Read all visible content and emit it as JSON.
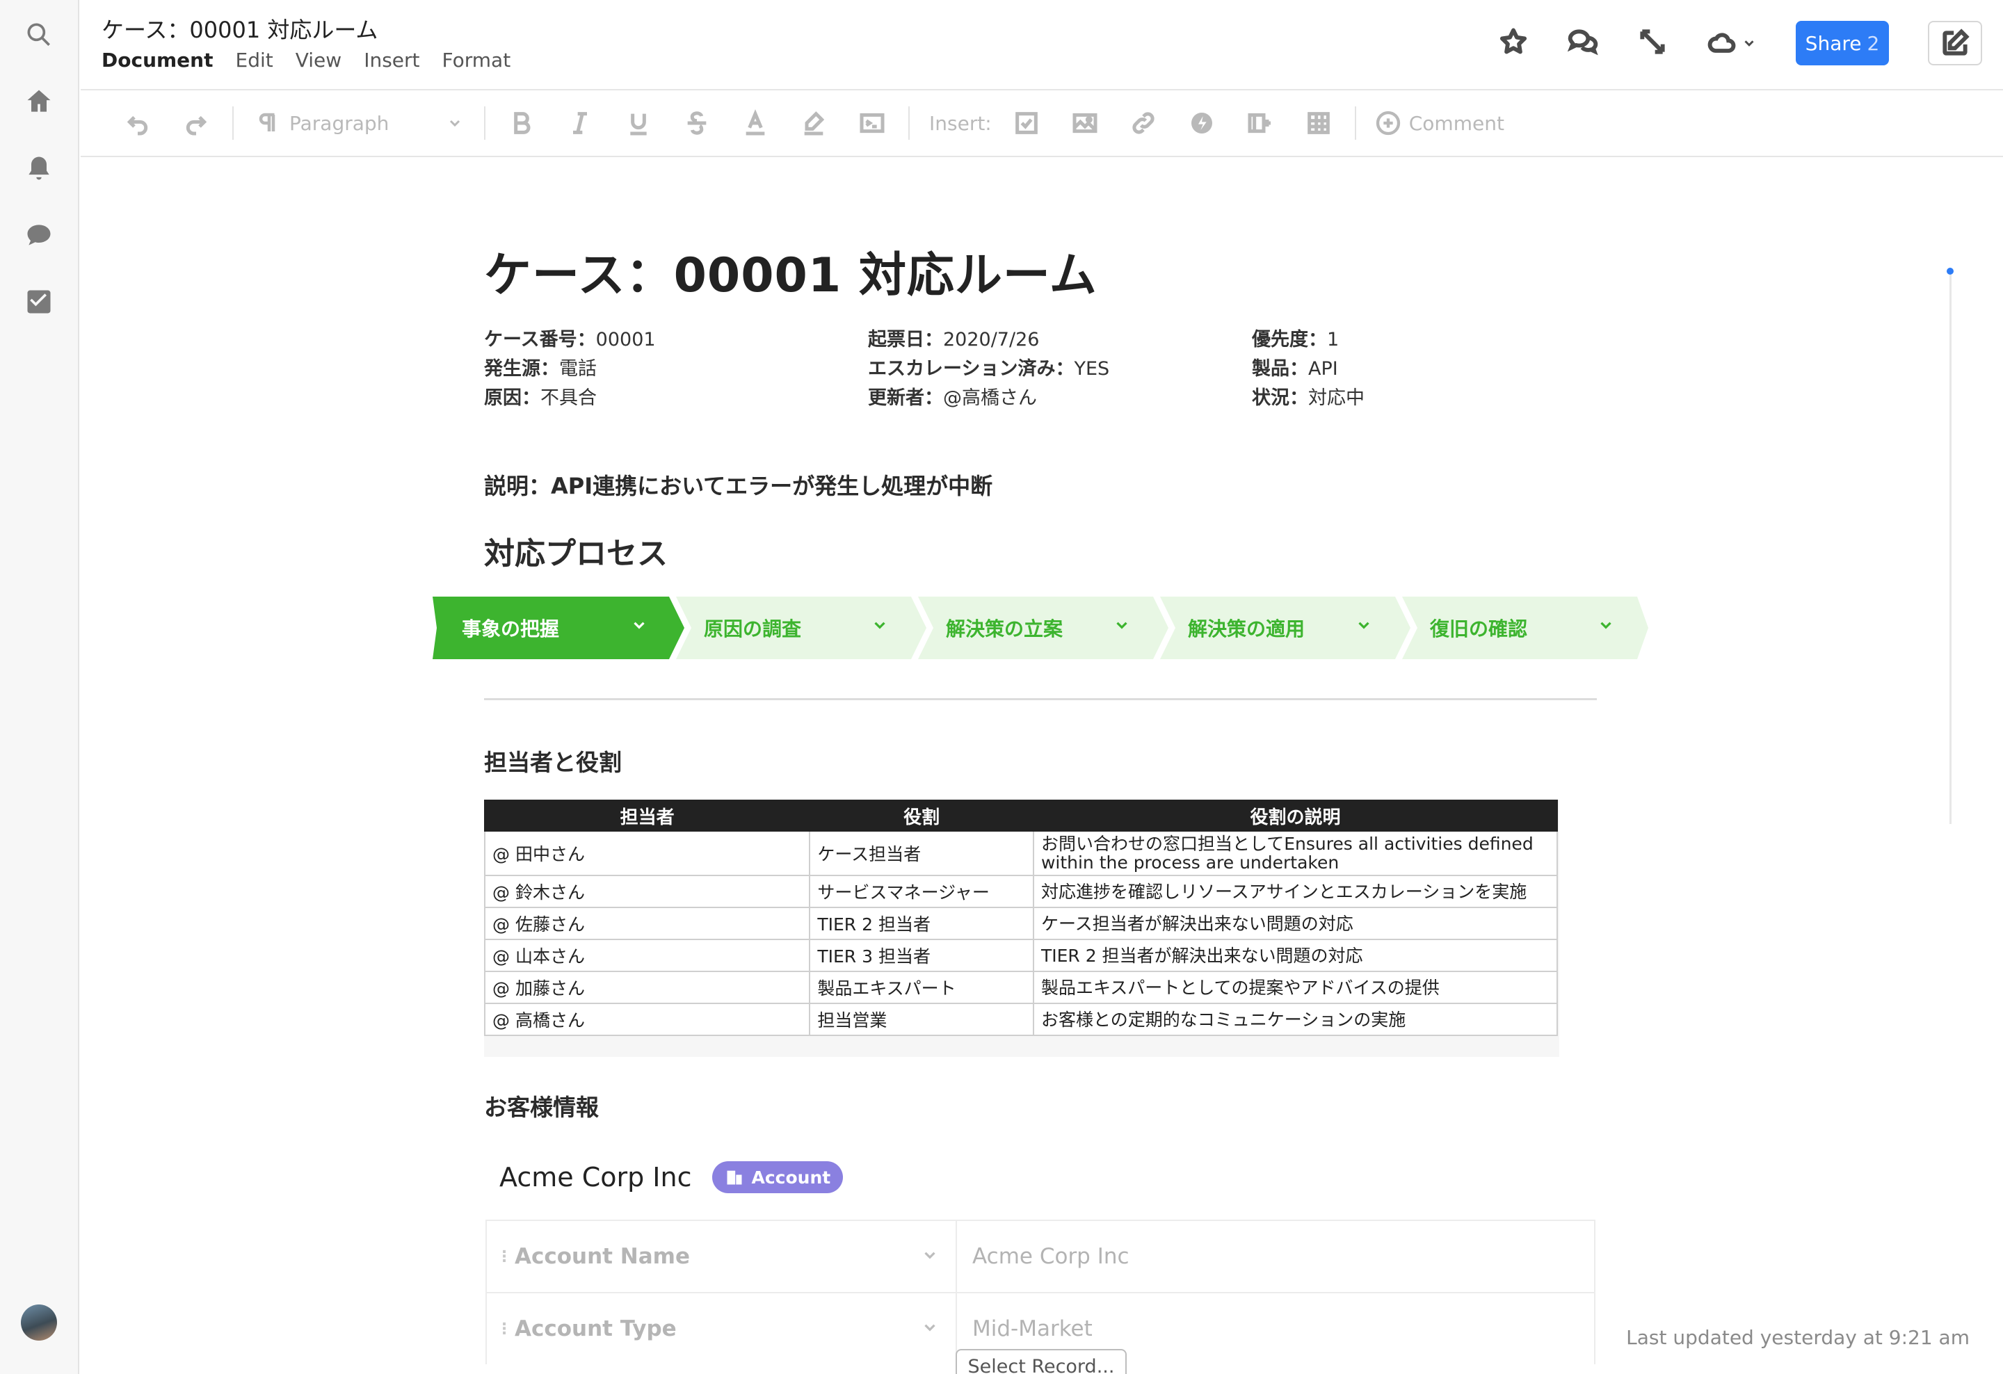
{
  "rail": {
    "icons": [
      "search-icon",
      "home-icon",
      "bell-icon",
      "chat-bubble-icon",
      "checkbox-icon"
    ]
  },
  "header": {
    "doc_title": "ケース：00001 対応ルーム",
    "menu": [
      "Document",
      "Edit",
      "View",
      "Insert",
      "Format"
    ],
    "share_label": "Share",
    "share_count": "2"
  },
  "toolbar": {
    "paragraph_label": "Paragraph",
    "insert_label": "Insert:",
    "comment_label": "Comment"
  },
  "doc": {
    "title": "ケース：00001 対応ルーム",
    "meta": [
      {
        "key": "ケース番号：",
        "value": "00001"
      },
      {
        "key": "発生源：",
        "value": "電話"
      },
      {
        "key": "原因：",
        "value": "不具合"
      },
      {
        "key": "起票日：",
        "value": "2020/7/26"
      },
      {
        "key": "エスカレーション済み：",
        "value": "YES"
      },
      {
        "key": "更新者：",
        "value": "@高橋さん"
      },
      {
        "key": "優先度：",
        "value": "1"
      },
      {
        "key": "製品：",
        "value": "API"
      },
      {
        "key": "状況：",
        "value": "対応中"
      }
    ],
    "description": "説明：API連携においてエラーが発生し処理が中断",
    "process_heading": "対応プロセス",
    "steps": [
      "事象の把握",
      "原因の調査",
      "解決策の立案",
      "解決策の適用",
      "復旧の確認"
    ],
    "active_step": 0,
    "roles_heading": "担当者と役割",
    "roles_table": {
      "headers": [
        "担当者",
        "役割",
        "役割の説明"
      ],
      "rows": [
        [
          "@ 田中さん",
          "ケース担当者",
          "お問い合わせの窓口担当としてEnsures all activities defined within the process are undertaken"
        ],
        [
          "@ 鈴木さん",
          "サービスマネージャー",
          "対応進捗を確認しリソースアサインとエスカレーションを実施"
        ],
        [
          "@ 佐藤さん",
          "TIER 2 担当者",
          "ケース担当者が解決出来ない問題の対応"
        ],
        [
          "@ 山本さん",
          "TIER 3 担当者",
          "TIER 2 担当者が解決出来ない問題の対応"
        ],
        [
          "@ 加藤さん",
          "製品エキスパート",
          "製品エキスパートとしての提案やアドバイスの提供"
        ],
        [
          "@ 高橋さん",
          "担当営業",
          "お客様との定期的なコミュニケーションの実施"
        ]
      ]
    },
    "customer_heading": "お客様情報",
    "account": {
      "name": "Acme Corp Inc",
      "badge": "Account",
      "fields": [
        {
          "label": "Account Name",
          "value": "Acme Corp Inc"
        },
        {
          "label": "Account Type",
          "value": "Mid-Market"
        }
      ],
      "select_record_label": "Select Record..."
    }
  },
  "footer": {
    "last_updated": "Last updated yesterday at 9:21 am"
  },
  "colors": {
    "accent_blue": "#2d7cf6",
    "step_active": "#3db42f",
    "step_inactive": "#e8f7e4",
    "badge_purple": "#8a80e0"
  }
}
